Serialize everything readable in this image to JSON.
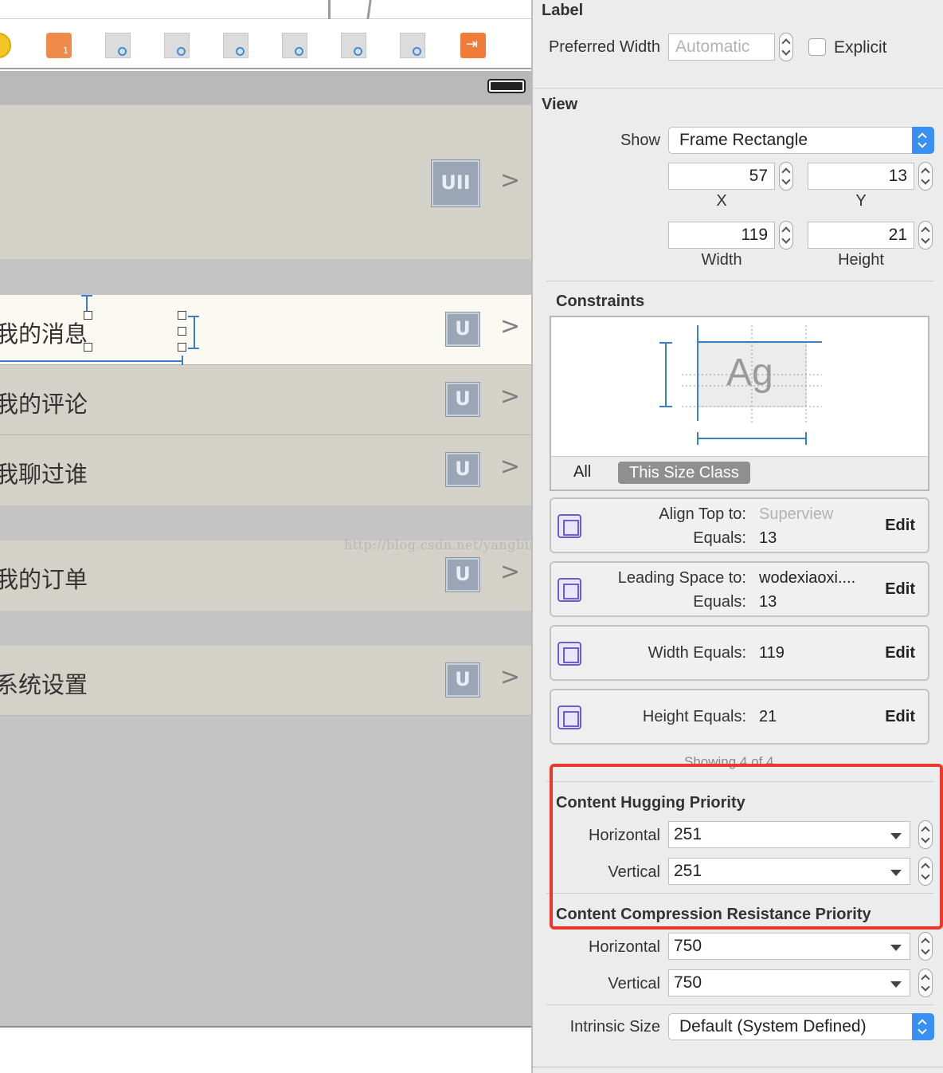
{
  "canvas": {
    "cells": [
      {
        "label": "",
        "placeholder": "UII"
      },
      {
        "label": "我的消息",
        "placeholder": "U"
      },
      {
        "label": "我的评论",
        "placeholder": "U"
      },
      {
        "label": "我聊过谁",
        "placeholder": "U"
      },
      {
        "label": "我的订单",
        "placeholder": "U"
      },
      {
        "label": "系统设置",
        "placeholder": "U"
      }
    ],
    "chevron": ">",
    "watermark": "http://blog.csdn.net/yangbingbinga",
    "dock_badge": "1"
  },
  "inspector": {
    "label_section": {
      "title": "Label",
      "preferred_width_label": "Preferred Width",
      "preferred_width_value": "Automatic",
      "explicit_label": "Explicit"
    },
    "view_section": {
      "title": "View",
      "show_label": "Show",
      "show_value": "Frame Rectangle",
      "x": "57",
      "x_caption": "X",
      "y": "13",
      "y_caption": "Y",
      "width": "119",
      "width_caption": "Width",
      "height": "21",
      "height_caption": "Height"
    },
    "constraints_section": {
      "title": "Constraints",
      "preview_text": "Ag",
      "tab_all": "All",
      "tab_size_class": "This Size Class",
      "rows": [
        {
          "line1_label": "Align Top to:",
          "line1_value": "Superview",
          "line2_label": "Equals:",
          "line2_value": "13",
          "edit": "Edit"
        },
        {
          "line1_label": "Leading Space to:",
          "line1_value": "wodexiaoxi....",
          "line2_label": "Equals:",
          "line2_value": "13",
          "edit": "Edit"
        },
        {
          "line1_label": "Width Equals:",
          "line1_value": "119",
          "edit": "Edit"
        },
        {
          "line1_label": "Height Equals:",
          "line1_value": "21",
          "edit": "Edit"
        }
      ],
      "showing": "Showing 4 of 4"
    },
    "hugging": {
      "title": "Content Hugging Priority",
      "horizontal_label": "Horizontal",
      "horizontal_value": "251",
      "vertical_label": "Vertical",
      "vertical_value": "251"
    },
    "compression": {
      "title": "Content Compression Resistance Priority",
      "horizontal_label": "Horizontal",
      "horizontal_value": "750",
      "vertical_label": "Vertical",
      "vertical_value": "750"
    },
    "intrinsic": {
      "label": "Intrinsic Size",
      "value": "Default (System Defined)"
    }
  },
  "colors": {
    "highlight": "#e8392c",
    "accent": "#3a8ff5",
    "constraint_icon": "#6b5fcf"
  }
}
